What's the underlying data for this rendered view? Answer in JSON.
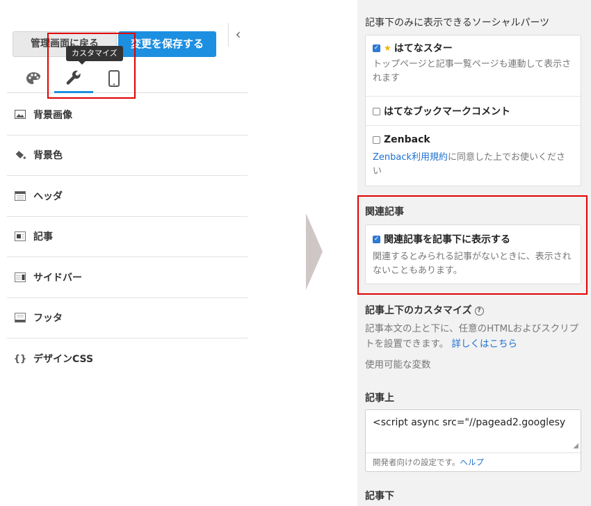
{
  "left": {
    "back_button": "管理画面に戻る",
    "save_button": "変更を保存する",
    "collapse_icon": "‹",
    "tooltip": "カスタマイズ",
    "tabs": [
      {
        "icon": "palette-icon"
      },
      {
        "icon": "wrench-icon",
        "active": true
      },
      {
        "icon": "smartphone-icon"
      }
    ],
    "menu": [
      {
        "label": "背景画像",
        "icon": "image-icon"
      },
      {
        "label": "背景色",
        "icon": "paint-bucket-icon"
      },
      {
        "label": "ヘッダ",
        "icon": "header-layout-icon"
      },
      {
        "label": "記事",
        "icon": "article-layout-icon"
      },
      {
        "label": "サイドバー",
        "icon": "sidebar-layout-icon"
      },
      {
        "label": "フッタ",
        "icon": "footer-layout-icon"
      },
      {
        "label": "デザインCSS",
        "icon": "braces-icon"
      }
    ]
  },
  "right": {
    "social_title": "記事下のみに表示できるソーシャルパーツ",
    "social": {
      "hatena_star": {
        "label": "はてなスター",
        "checked": true,
        "desc": "トップページと記事一覧ページも連動して表示されます"
      },
      "bookmark": {
        "label": "はてなブックマークコメント",
        "checked": false
      },
      "zenback": {
        "label": "Zenback",
        "checked": false,
        "link": "Zenback利用規約",
        "desc": "に同意した上でお使いください"
      }
    },
    "related_title": "関連記事",
    "related": {
      "label": "関連記事を記事下に表示する",
      "checked": true,
      "desc": "関連するとみられる記事がないときに、表示されないこともあります。"
    },
    "custom_title": "記事上下のカスタマイズ",
    "custom_help": "?",
    "custom_desc": "記事本文の上と下に、任意のHTMLおよびスクリプトを設置できます。",
    "custom_link": "詳しくはこちら",
    "vars_link": "使用可能な変数",
    "top_title": "記事上",
    "top_code": "<script async src=\"//pagead2.googlesy",
    "dev_note": "開発者向けの設定です。",
    "help_link": "ヘルプ",
    "bottom_title": "記事下"
  },
  "colors": {
    "accent": "#1d8fe0",
    "highlight": "#e00000",
    "panel": "#f2f2f2"
  }
}
